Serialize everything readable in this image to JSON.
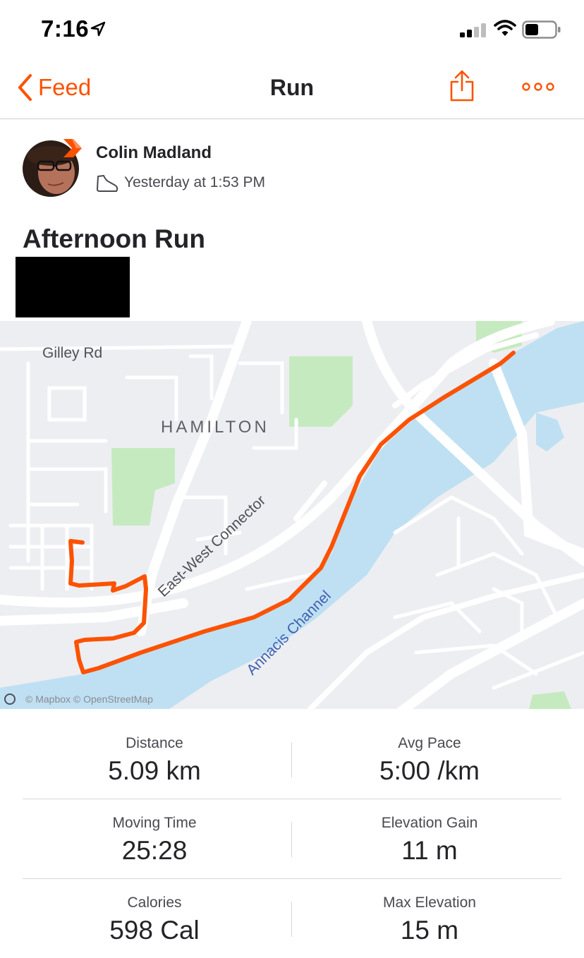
{
  "status_bar": {
    "time": "7:16"
  },
  "nav": {
    "back_label": "Feed",
    "title": "Run"
  },
  "activity": {
    "athlete": "Colin Madland",
    "date": "Yesterday at 1:53 PM",
    "title": "Afternoon Run"
  },
  "map": {
    "labels": {
      "road1": "Gilley Rd",
      "area": "HAMILTON",
      "road2": "East-West Connector",
      "water": "Annacis Channel"
    },
    "attribution": "© Mapbox © OpenStreetMap",
    "route_color": "#fc5200",
    "water_color": "#bfe0f2",
    "park_color": "#c6eac0"
  },
  "stats": [
    {
      "label": "Distance",
      "value": "5.09 km"
    },
    {
      "label": "Avg Pace",
      "value": "5:00 /km"
    },
    {
      "label": "Moving Time",
      "value": "25:28"
    },
    {
      "label": "Elevation Gain",
      "value": "11 m"
    },
    {
      "label": "Calories",
      "value": "598 Cal"
    },
    {
      "label": "Max Elevation",
      "value": "15 m"
    }
  ],
  "colors": {
    "accent": "#fc5200",
    "text": "#242428"
  }
}
